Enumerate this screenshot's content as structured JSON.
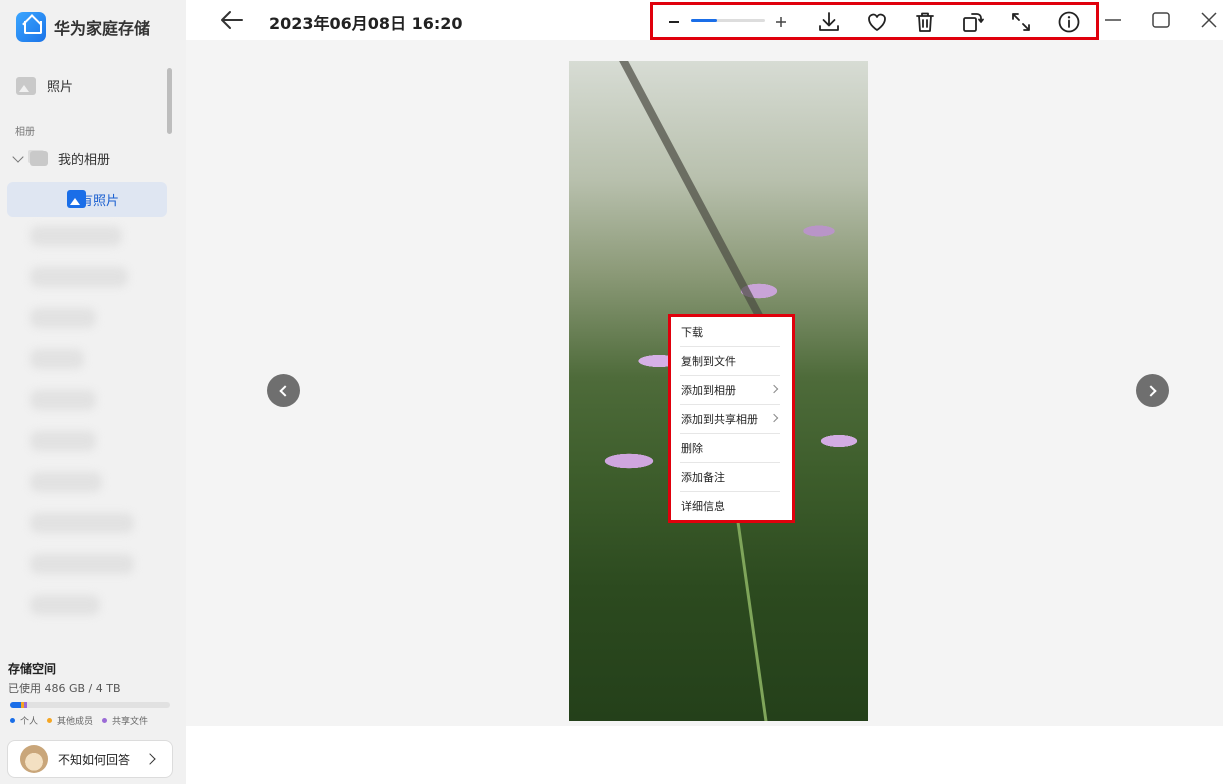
{
  "app": {
    "title": "华为家庭存储",
    "logo_icon": "home-storage-icon"
  },
  "sidebar": {
    "photos_label": "照片",
    "section_label": "相册",
    "my_albums_label": "我的相册",
    "all_photos_label": "所有照片",
    "storage": {
      "title": "存储空间",
      "usage": "已使用 486 GB / 4 TB",
      "legend": [
        {
          "label": "个人",
          "color": "#1a6ee8"
        },
        {
          "label": "其他成员",
          "color": "#f5a623"
        },
        {
          "label": "共享文件",
          "color": "#9b6bd6"
        }
      ]
    },
    "account": {
      "name": "不知如何回答"
    }
  },
  "viewer": {
    "title": "2023年06月08日 16:20",
    "toolbar": {
      "zoom_out_icon": "minus-icon",
      "zoom_in_icon": "plus-icon",
      "zoom_level": 0.35,
      "download_icon": "download-icon",
      "favorite_icon": "heart-icon",
      "delete_icon": "trash-icon",
      "rotate_icon": "rotate-icon",
      "fullscreen_icon": "expand-icon",
      "info_icon": "info-icon",
      "accent": "#1a6ee8"
    },
    "highlight_color": "#e0000c",
    "context_menu": {
      "items": [
        {
          "label": "下载"
        },
        {
          "label": "复制到文件"
        },
        {
          "label": "添加到相册"
        },
        {
          "label": "添加到共享相册"
        },
        {
          "label": "删除"
        },
        {
          "label": "添加备注"
        },
        {
          "label": "详细信息"
        }
      ]
    }
  }
}
